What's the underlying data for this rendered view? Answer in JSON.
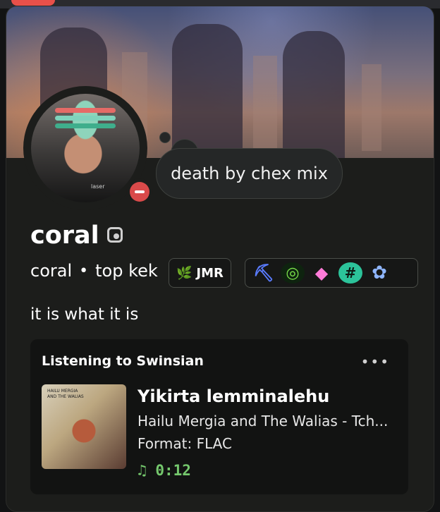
{
  "colors": {
    "card_background": "#1c1d1b",
    "status_dnd": "#d94a4a",
    "timer_green": "#75c86d"
  },
  "profile": {
    "display_name": "coral",
    "nickname_icon": "nickname-icon",
    "avatar_text": "laser",
    "username": "coral",
    "pronouns": "top kek",
    "status_message": "death by chex mix",
    "bio": "it is what it is",
    "tag": {
      "icon": "guild-tag-icon",
      "label": "JMR"
    }
  },
  "badges": [
    {
      "name": "active-developer-badge",
      "glyph": "⛏"
    },
    {
      "name": "nitro-badge",
      "glyph": "◎"
    },
    {
      "name": "gem-badge",
      "glyph": "◆"
    },
    {
      "name": "hashtag-badge",
      "glyph": "#"
    },
    {
      "name": "quest-badge",
      "glyph": "✿"
    }
  ],
  "activity": {
    "header": "Listening to Swinsian",
    "menu": "•••",
    "title": "Yikirta lemminalehu",
    "artist": "Hailu Mergia and The Walias - Tch...",
    "format": "Format: FLAC",
    "time_icon": "♫",
    "time": "0:12",
    "cover_text": [
      "HAILU MERGIA",
      "AND THE WALIAS"
    ]
  }
}
